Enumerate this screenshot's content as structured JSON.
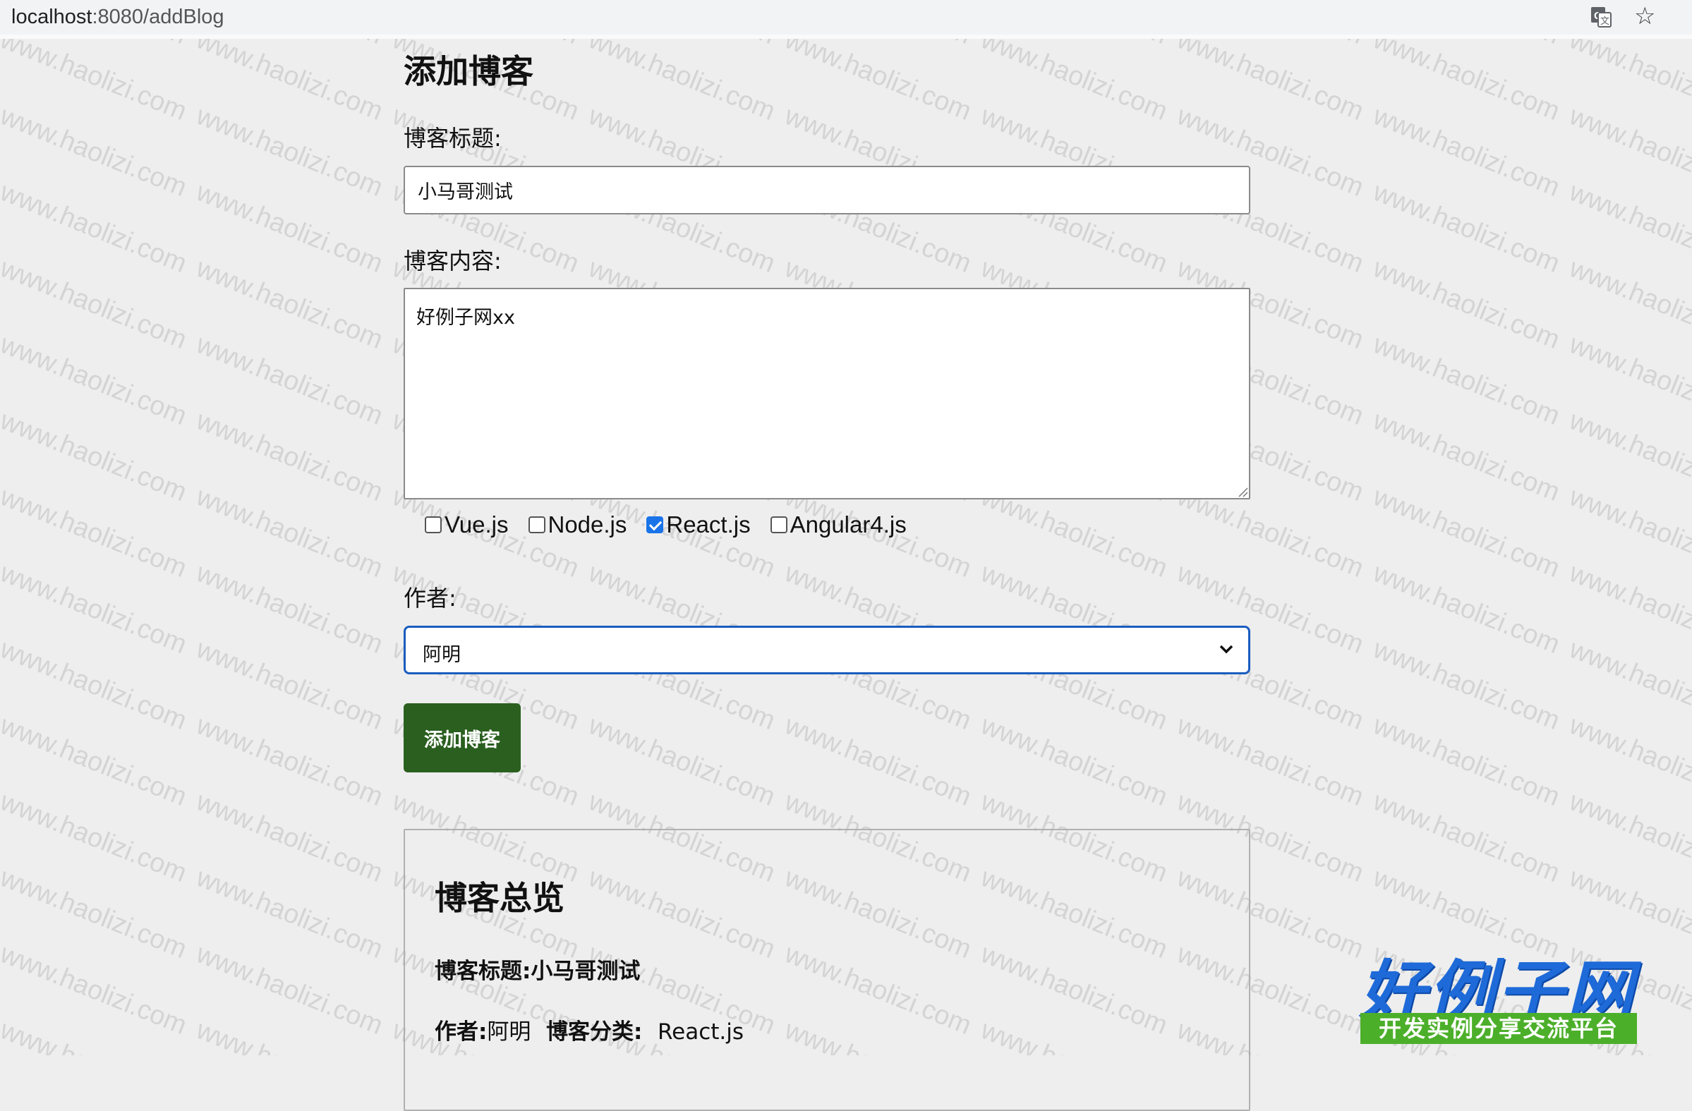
{
  "browser": {
    "url_host": "localhost",
    "url_path": ":8080/addBlog",
    "translate_icon": "translate-icon",
    "bookmark_icon": "star-icon"
  },
  "form": {
    "heading": "添加博客",
    "title_label": "博客标题:",
    "title_value": "小马哥测试",
    "content_label": "博客内容:",
    "content_value": "好例子网xx",
    "categories": [
      {
        "label": "Vue.js",
        "checked": false
      },
      {
        "label": "Node.js",
        "checked": false
      },
      {
        "label": "React.js",
        "checked": true
      },
      {
        "label": "Angular4.js",
        "checked": false
      }
    ],
    "author_label": "作者:",
    "author_value": "阿明",
    "submit_label": "添加博客"
  },
  "preview": {
    "heading": "博客总览",
    "title_label": "博客标题:",
    "title_value": "小马哥测试",
    "author_label": "作者:",
    "author_value": "阿明",
    "category_label": "博客分类:",
    "category_value": "React.js"
  },
  "watermark": {
    "text": "www.haolizi.com"
  },
  "logo": {
    "main": "好例子网",
    "sub": "开发实例分享交流平台"
  },
  "colors": {
    "button": "#2a5f1f",
    "select_focus": "#1a5dbf",
    "logo_blue": "#1e6ad8",
    "logo_green": "#4caf2a"
  }
}
